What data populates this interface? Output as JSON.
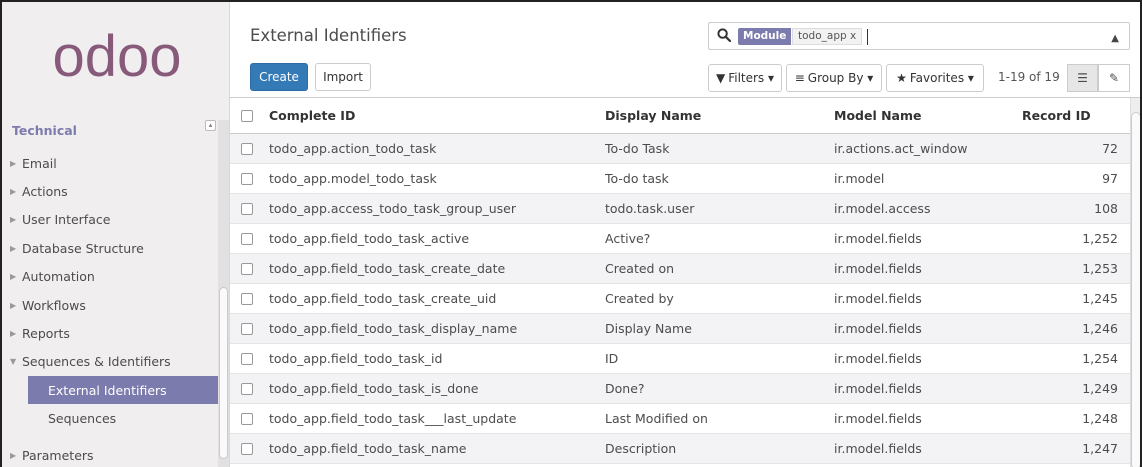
{
  "brand": {
    "logo_text": "odoo",
    "logo_color": "#875a7b"
  },
  "sidebar": {
    "section_title": "Technical",
    "items": [
      {
        "label": "Email",
        "top": 0,
        "type": "collapsed"
      },
      {
        "label": "Actions",
        "type": "collapsed"
      },
      {
        "label": "User Interface",
        "type": "collapsed"
      },
      {
        "label": "Database Structure",
        "type": "collapsed"
      },
      {
        "label": "Automation",
        "type": "collapsed"
      },
      {
        "label": "Workflows",
        "type": "collapsed"
      },
      {
        "label": "Reports",
        "type": "collapsed"
      },
      {
        "label": "Sequences & Identifiers",
        "type": "expanded"
      },
      {
        "label": "External Identifiers",
        "type": "active"
      },
      {
        "label": "Sequences",
        "type": "sub"
      },
      {
        "label": "Parameters",
        "type": "collapsed"
      }
    ]
  },
  "header": {
    "title": "External Identifiers",
    "create_label": "Create",
    "import_label": "Import",
    "search": {
      "facet_label": "Module",
      "facet_value": "todo_app x"
    },
    "filters_label": "Filters ▾",
    "groupby_label": "Group By ▾",
    "favorites_label": "Favorites ▾",
    "pager": "1-19 of 19"
  },
  "table": {
    "columns": [
      "Complete ID",
      "Display Name",
      "Model Name",
      "Record ID"
    ],
    "rows": [
      [
        "todo_app.action_todo_task",
        "To-do Task",
        "ir.actions.act_window",
        "72"
      ],
      [
        "todo_app.model_todo_task",
        "To-do task",
        "ir.model",
        "97"
      ],
      [
        "todo_app.access_todo_task_group_user",
        "todo.task.user",
        "ir.model.access",
        "108"
      ],
      [
        "todo_app.field_todo_task_active",
        "Active?",
        "ir.model.fields",
        "1,252"
      ],
      [
        "todo_app.field_todo_task_create_date",
        "Created on",
        "ir.model.fields",
        "1,253"
      ],
      [
        "todo_app.field_todo_task_create_uid",
        "Created by",
        "ir.model.fields",
        "1,245"
      ],
      [
        "todo_app.field_todo_task_display_name",
        "Display Name",
        "ir.model.fields",
        "1,246"
      ],
      [
        "todo_app.field_todo_task_id",
        "ID",
        "ir.model.fields",
        "1,254"
      ],
      [
        "todo_app.field_todo_task_is_done",
        "Done?",
        "ir.model.fields",
        "1,249"
      ],
      [
        "todo_app.field_todo_task___last_update",
        "Last Modified on",
        "ir.model.fields",
        "1,248"
      ],
      [
        "todo_app.field_todo_task_name",
        "Description",
        "ir.model.fields",
        "1,247"
      ]
    ]
  }
}
